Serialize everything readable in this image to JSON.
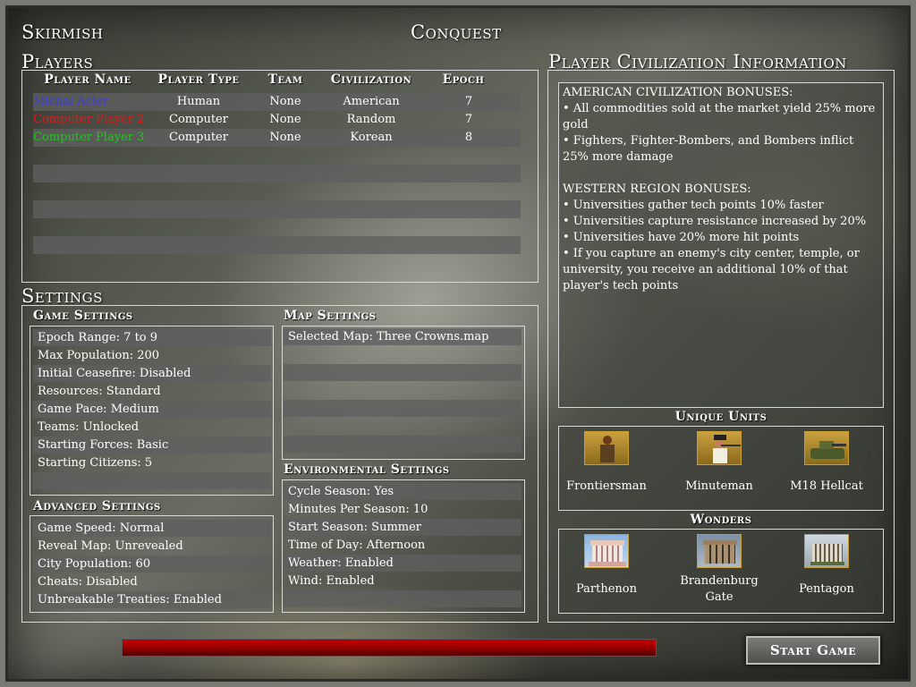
{
  "header": {
    "mode": "Skirmish",
    "game_type": "Conquest"
  },
  "players": {
    "title": "Players",
    "columns": [
      "Player Name",
      "Player Type",
      "Team",
      "Civilization",
      "Epoch"
    ],
    "rows": [
      {
        "name": "Michal Acler",
        "type": "Human",
        "team": "None",
        "civ": "American",
        "epoch": "7",
        "color": "#3d3dd8"
      },
      {
        "name": "Computer Player 2",
        "type": "Computer",
        "team": "None",
        "civ": "Random",
        "epoch": "7",
        "color": "#d81c1c"
      },
      {
        "name": "Computer Player 3",
        "type": "Computer",
        "team": "None",
        "civ": "Korean",
        "epoch": "8",
        "color": "#23c41f"
      }
    ]
  },
  "settings": {
    "title": "Settings",
    "game": {
      "title": "Game Settings",
      "items": [
        "Epoch Range: 7 to 9",
        "Max Population: 200",
        "Initial Ceasefire: Disabled",
        "Resources: Standard",
        "Game Pace: Medium",
        "Teams: Unlocked",
        "Starting Forces: Basic",
        "Starting Citizens: 5"
      ]
    },
    "advanced": {
      "title": "Advanced Settings",
      "items": [
        "Game Speed: Normal",
        "Reveal Map: Unrevealed",
        "City Population: 60",
        "Cheats: Disabled",
        "Unbreakable Treaties: Enabled"
      ]
    },
    "map": {
      "title": "Map Settings",
      "items": [
        "Selected Map: Three Crowns.map"
      ]
    },
    "environment": {
      "title": "Environmental Settings",
      "items": [
        "Cycle Season: Yes",
        "Minutes Per Season: 10",
        "Start Season: Summer",
        "Time of Day: Afternoon",
        "Weather: Enabled",
        "Wind: Enabled"
      ]
    }
  },
  "civ_info": {
    "title": "Player Civilization Information",
    "civ_heading": "AMERICAN CIVILIZATION BONUSES:",
    "civ_bonuses": [
      "• All commodities sold at the market yield 25% more gold",
      "• Fighters, Fighter-Bombers, and Bombers inflict 25% more damage"
    ],
    "region_heading": "WESTERN REGION BONUSES:",
    "region_bonuses": [
      "• Universities gather tech points 10% faster",
      "• Universities capture resistance increased by 20%",
      "• Universities have 20% more hit points",
      "•  If you capture an enemy's city center, temple, or university, you receive an additional 10% of that player's tech points"
    ]
  },
  "unique_units": {
    "title": "Unique Units",
    "items": [
      {
        "name": "Frontiersman",
        "icon": "frontiersman-icon"
      },
      {
        "name": "Minuteman",
        "icon": "minuteman-icon"
      },
      {
        "name": "M18 Hellcat",
        "icon": "tank-icon"
      }
    ]
  },
  "wonders": {
    "title": "Wonders",
    "items": [
      {
        "name": "Parthenon",
        "icon": "parthenon-icon"
      },
      {
        "name": "Brandenburg Gate",
        "icon": "brandenburg-gate-icon"
      },
      {
        "name": "Pentagon",
        "icon": "pentagon-icon"
      }
    ]
  },
  "progress": {
    "value": 1.0,
    "color": "#c80000"
  },
  "start_button": {
    "label": "Start Game"
  }
}
